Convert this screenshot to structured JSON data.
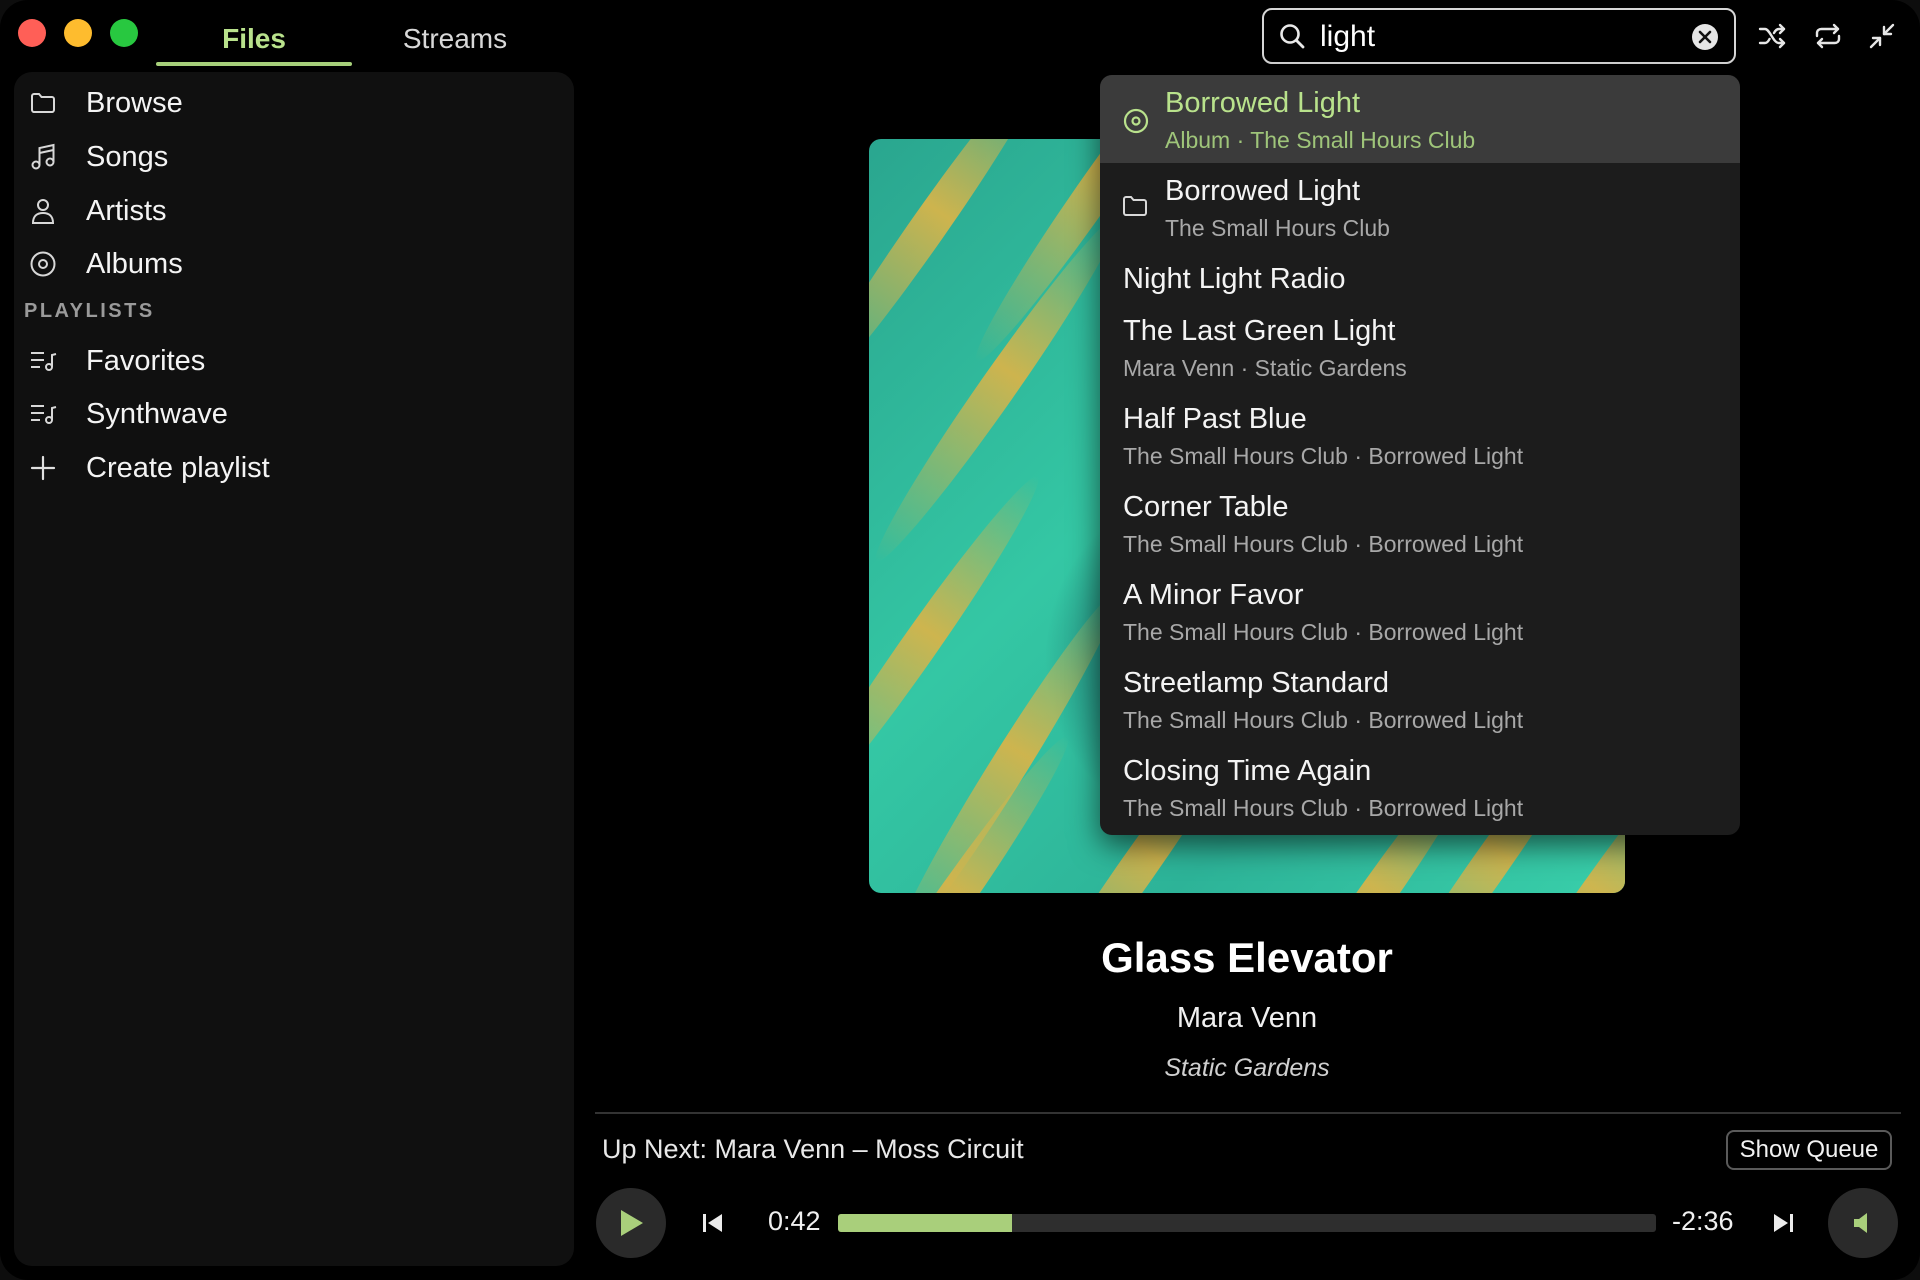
{
  "tabs": {
    "files": "Files",
    "streams": "Streams"
  },
  "search": {
    "value": "light"
  },
  "sidebar": {
    "items": [
      {
        "label": "Browse",
        "icon": "folder-icon"
      },
      {
        "label": "Songs",
        "icon": "music-note-icon"
      },
      {
        "label": "Artists",
        "icon": "person-icon"
      },
      {
        "label": "Albums",
        "icon": "disc-icon"
      }
    ],
    "playlists_label": "PLAYLISTS",
    "playlists": [
      {
        "label": "Favorites",
        "icon": "playlist-icon"
      },
      {
        "label": "Synthwave",
        "icon": "playlist-icon"
      }
    ],
    "create_playlist": "Create playlist"
  },
  "results": [
    {
      "title": "Borrowed Light",
      "subtitle": "Album · The Small Hours Club",
      "icon": "disc-icon",
      "selected": true
    },
    {
      "title": "Borrowed Light",
      "subtitle": "The Small Hours Club",
      "icon": "folder-icon"
    },
    {
      "title": "Night Light Radio",
      "subtitle": ""
    },
    {
      "title": "The Last Green Light",
      "subtitle": "Mara Venn · Static Gardens"
    },
    {
      "title": "Half Past Blue",
      "subtitle": "The Small Hours Club · Borrowed Light"
    },
    {
      "title": "Corner Table",
      "subtitle": "The Small Hours Club · Borrowed Light"
    },
    {
      "title": "A Minor Favor",
      "subtitle": "The Small Hours Club · Borrowed Light"
    },
    {
      "title": "Streetlamp Standard",
      "subtitle": "The Small Hours Club · Borrowed Light"
    },
    {
      "title": "Closing Time Again",
      "subtitle": "The Small Hours Club · Borrowed Light"
    }
  ],
  "now_playing": {
    "title": "Glass Elevator",
    "artist": "Mara Venn",
    "album": "Static Gardens"
  },
  "queue": {
    "up_next": "Up Next: Mara Venn – Moss Circuit",
    "show_queue": "Show Queue"
  },
  "transport": {
    "elapsed": "0:42",
    "remaining": "-2:36",
    "progress_fraction": 0.2125
  },
  "colors": {
    "accent": "#b9e28c",
    "progress_fill": "#a9cf7b",
    "window_bg": "#000000",
    "sidebar_bg": "#101010",
    "dropdown_bg": "#1c1c1c",
    "selected_row_bg": "#3b3b3b"
  }
}
